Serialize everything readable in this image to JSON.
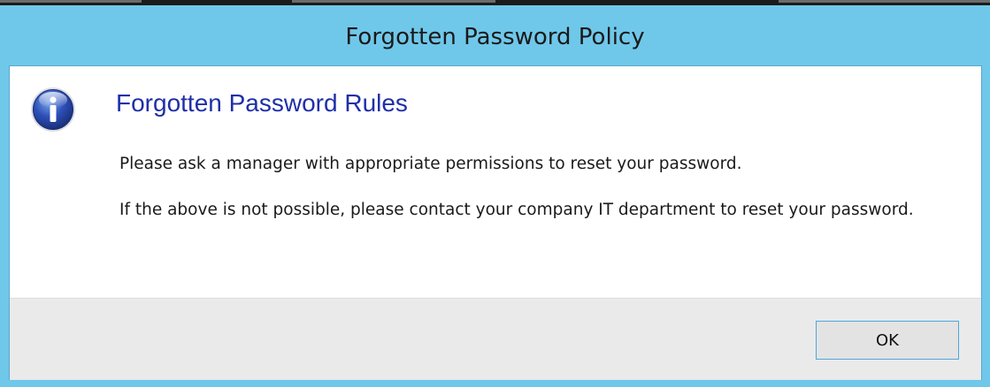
{
  "window": {
    "title": "Forgotten Password Policy"
  },
  "dialog": {
    "icon": "info-icon",
    "heading": "Forgotten Password Rules",
    "paragraphs": [
      "Please ask a manager with appropriate permissions to reset your password.",
      "If the above is not possible, please contact your company IT department to reset your password."
    ],
    "ok_label": "OK"
  },
  "colors": {
    "titlebar": "#6fc8ea",
    "heading": "#1f2fa8",
    "footer": "#eaeaea",
    "button_border": "#4ea7dd"
  }
}
